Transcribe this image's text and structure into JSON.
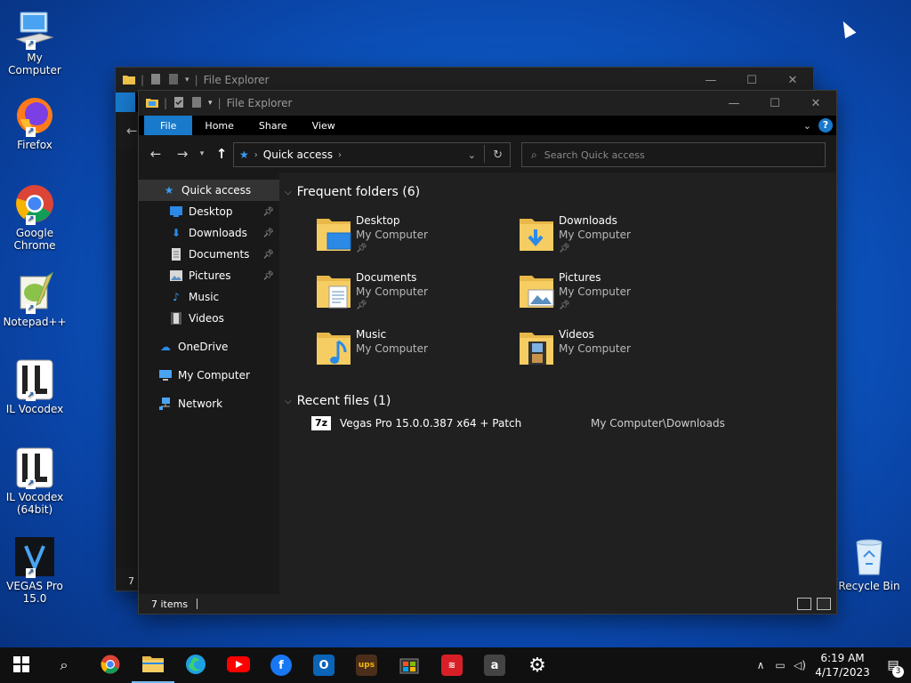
{
  "desktop": {
    "icons": [
      {
        "label": "My Computer",
        "icon": "monitor-icon"
      },
      {
        "label": "Firefox",
        "icon": "firefox-icon"
      },
      {
        "label": "Google Chrome",
        "icon": "chrome-icon"
      },
      {
        "label": "Notepad++",
        "icon": "notepadpp-icon"
      },
      {
        "label": "IL Vocodex",
        "icon": "il-vocodex-icon"
      },
      {
        "label": "IL Vocodex (64bit)",
        "icon": "il-vocodex-icon"
      },
      {
        "label": "VEGAS Pro 15.0",
        "icon": "vegas-icon"
      }
    ],
    "recycle_bin": {
      "label": "Recycle Bin",
      "icon": "recycle-bin-icon"
    }
  },
  "back_window": {
    "title": "File Explorer",
    "status_partial": "7 i"
  },
  "explorer": {
    "title": "File Explorer",
    "ribbon_tabs": [
      "File",
      "Home",
      "Share",
      "View"
    ],
    "help_label": "?",
    "address": {
      "location": "Quick access"
    },
    "search": {
      "placeholder": "Search Quick access"
    },
    "sidebar": {
      "items": [
        {
          "label": "Quick access",
          "icon": "star-icon",
          "color": "#3b9cf5"
        },
        {
          "label": "Desktop",
          "icon": "desktop-folder-icon",
          "color": "#2a8ae6",
          "pinned": true
        },
        {
          "label": "Downloads",
          "icon": "download-arrow-icon",
          "color": "#2a8ae6",
          "pinned": true
        },
        {
          "label": "Documents",
          "icon": "document-icon",
          "color": "#d8d8d8",
          "pinned": true
        },
        {
          "label": "Pictures",
          "icon": "picture-icon",
          "color": "#d8d8d8",
          "pinned": true
        },
        {
          "label": "Music",
          "icon": "music-note-icon",
          "color": "#3b9cf5"
        },
        {
          "label": "Videos",
          "icon": "film-icon",
          "color": "#d8d8d8"
        },
        {
          "label": "OneDrive",
          "icon": "cloud-icon",
          "color": "#2a8ae6"
        },
        {
          "label": "My Computer",
          "icon": "monitor-icon",
          "color": "#4aa3f0"
        },
        {
          "label": "Network",
          "icon": "network-icon",
          "color": "#4aa3f0"
        }
      ]
    },
    "frequent_header": "Frequent folders (6)",
    "frequent_folders": [
      {
        "name": "Desktop",
        "location": "My Computer",
        "pinned": true,
        "overlay": "desktop"
      },
      {
        "name": "Downloads",
        "location": "My Computer",
        "pinned": true,
        "overlay": "download"
      },
      {
        "name": "Documents",
        "location": "My Computer",
        "pinned": true,
        "overlay": "document"
      },
      {
        "name": "Pictures",
        "location": "My Computer",
        "pinned": true,
        "overlay": "picture"
      },
      {
        "name": "Music",
        "location": "My Computer",
        "pinned": false,
        "overlay": "music"
      },
      {
        "name": "Videos",
        "location": "My Computer",
        "pinned": false,
        "overlay": "video"
      }
    ],
    "recent_header": "Recent files (1)",
    "recent_files": [
      {
        "name": "Vegas Pro 15.0.0.387 x64 + Patch",
        "location": "My Computer\\Downloads",
        "icon_label": "7z"
      }
    ],
    "status": {
      "count": "7 items"
    }
  },
  "taskbar": {
    "apps": [
      {
        "name": "start-button",
        "icon": "windows-logo-icon"
      },
      {
        "name": "search-button",
        "icon": "search-icon"
      },
      {
        "name": "chrome-taskbar",
        "icon": "chrome-icon"
      },
      {
        "name": "file-explorer-taskbar",
        "icon": "folder-icon"
      },
      {
        "name": "edge-taskbar",
        "icon": "edge-icon"
      },
      {
        "name": "youtube-taskbar",
        "icon": "youtube-icon"
      },
      {
        "name": "facebook-taskbar",
        "icon": "facebook-icon"
      },
      {
        "name": "outlook-taskbar",
        "icon": "outlook-icon"
      },
      {
        "name": "ups-taskbar",
        "icon": "ups-icon"
      },
      {
        "name": "store-taskbar",
        "icon": "store-bag-icon"
      },
      {
        "name": "netflix-taskbar",
        "icon": "netflix-icon"
      },
      {
        "name": "amazon-taskbar",
        "icon": "amazon-icon"
      },
      {
        "name": "settings-taskbar",
        "icon": "gear-icon"
      }
    ],
    "clock": {
      "time": "6:19 AM",
      "date": "4/17/2023"
    },
    "notification_count": "3"
  }
}
